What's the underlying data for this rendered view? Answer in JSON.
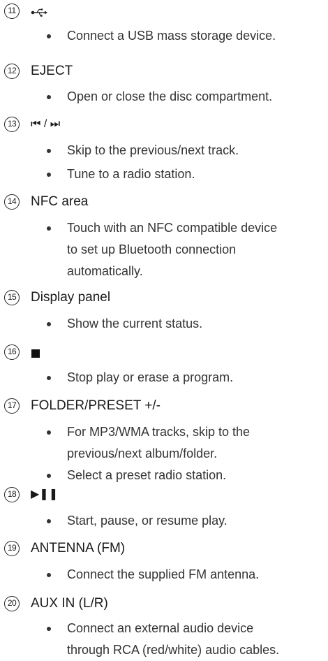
{
  "items": [
    {
      "number": "11",
      "title": "",
      "title_icon": "usb-icon",
      "bullets": [
        {
          "lines": [
            "Connect a USB mass storage device."
          ]
        }
      ]
    },
    {
      "number": "12",
      "title": "EJECT",
      "bullets": [
        {
          "lines": [
            "Open or close the disc compartment."
          ]
        }
      ]
    },
    {
      "number": "13",
      "title": "⏮ / ⏭",
      "bullets": [
        {
          "lines": [
            "Skip to the previous/next track."
          ]
        },
        {
          "lines": [
            "Tune to a radio station."
          ]
        }
      ]
    },
    {
      "number": "14",
      "title": "NFC area",
      "bullets": [
        {
          "lines": [
            "Touch with an NFC compatible device",
            "to set up Bluetooth connection",
            "automatically."
          ]
        }
      ]
    },
    {
      "number": "15",
      "title": "Display panel",
      "bullets": [
        {
          "lines": [
            "Show the current status."
          ]
        }
      ]
    },
    {
      "number": "16",
      "title": "",
      "title_icon": "stop-icon",
      "bullets": [
        {
          "lines": [
            "Stop play or erase a program."
          ]
        }
      ]
    },
    {
      "number": "17",
      "title": "FOLDER/PRESET +/-",
      "bullets": [
        {
          "lines": [
            "For MP3/WMA tracks, skip to the",
            "previous/next album/folder."
          ]
        },
        {
          "lines": [
            "Select a preset radio station."
          ]
        }
      ]
    },
    {
      "number": "18",
      "title": "▶❚❚",
      "bullets": [
        {
          "lines": [
            "Start, pause, or resume play."
          ]
        }
      ]
    },
    {
      "number": "19",
      "title": "ANTENNA (FM)",
      "bullets": [
        {
          "lines": [
            "Connect the supplied FM antenna."
          ]
        }
      ]
    },
    {
      "number": "20",
      "title": "AUX IN (L/R)",
      "bullets": [
        {
          "lines": [
            "Connect an external audio device",
            "through RCA (red/white) audio cables."
          ]
        }
      ]
    }
  ]
}
